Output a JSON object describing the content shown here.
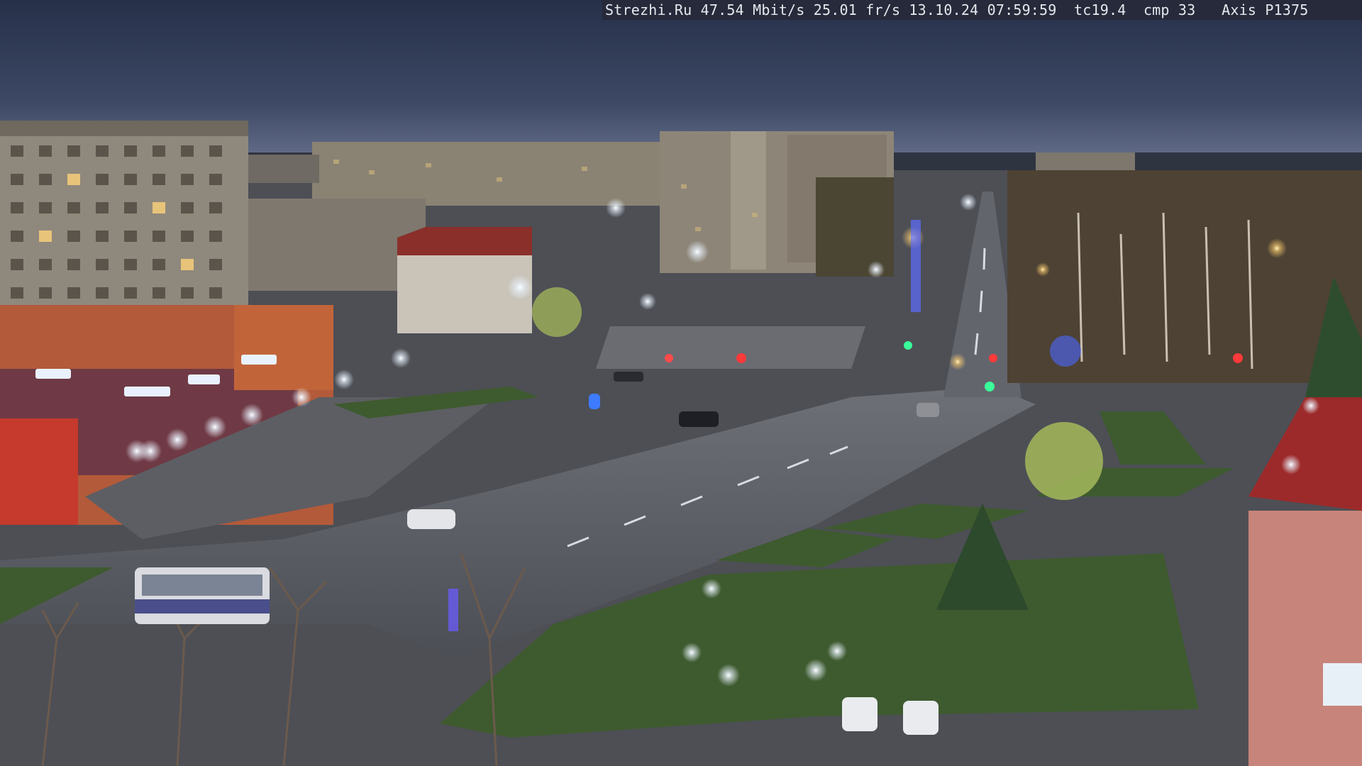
{
  "camera_overlay": {
    "text": "Strezhi.Ru 47.54 Mbit/s 25.01 fr/s 13.10.24 07:59:59  tc19.4  cmp 33   Axis P1375"
  },
  "scene": {
    "description_icon": "street-webcam-photo",
    "colors": {
      "sky_top": "#2c3550",
      "sky_bottom": "#5a6784",
      "road": "#5a5c63",
      "grass": "#3f5a2e",
      "building": "#8b8478",
      "building_dark": "#5d564e",
      "shop_red": "#b8462e",
      "light_warm": "#ffd27a",
      "light_cold": "#e8f2ff"
    }
  }
}
